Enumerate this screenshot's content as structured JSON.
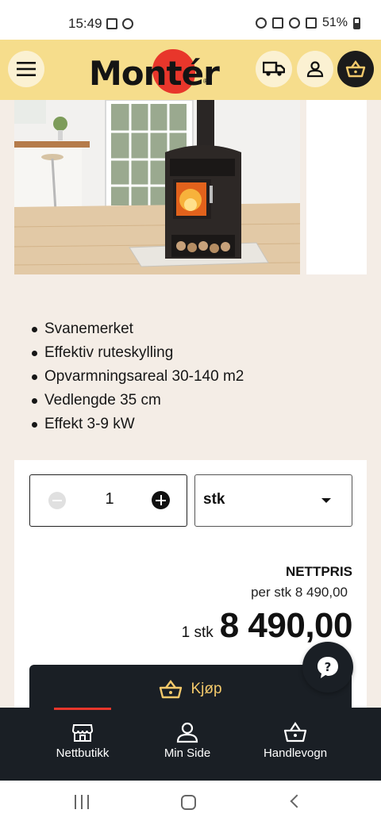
{
  "status_bar": {
    "time": "15:49",
    "battery": "51%"
  },
  "header": {
    "logo_text": "Montér",
    "logo_reg": "®",
    "brand_colors": {
      "yellow": "#f6dd8c",
      "red": "#e8362b",
      "dark": "#1a1f25"
    },
    "icons": [
      "menu-icon",
      "truck-icon",
      "user-icon",
      "basket-icon"
    ]
  },
  "product": {
    "features": [
      "Svanemerket",
      "Effektiv ruteskylling",
      "Opvarmningsareal 30-140 m2",
      "Vedlengde 35 cm",
      "Effekt 3-9 kW"
    ]
  },
  "purchase": {
    "quantity": "1",
    "unit": "stk",
    "price_label": "NETTPRIS",
    "per_unit": "per stk 8 490,00",
    "total_qty": "1 stk",
    "total_price": "8 490,00",
    "buy_label": "Kjøp"
  },
  "bottom_nav": {
    "items": [
      {
        "label": "Nettbutikk",
        "icon": "store-icon",
        "active": true
      },
      {
        "label": "Min Side",
        "icon": "user-icon",
        "active": false
      },
      {
        "label": "Handlevogn",
        "icon": "basket-icon",
        "active": false
      }
    ]
  }
}
